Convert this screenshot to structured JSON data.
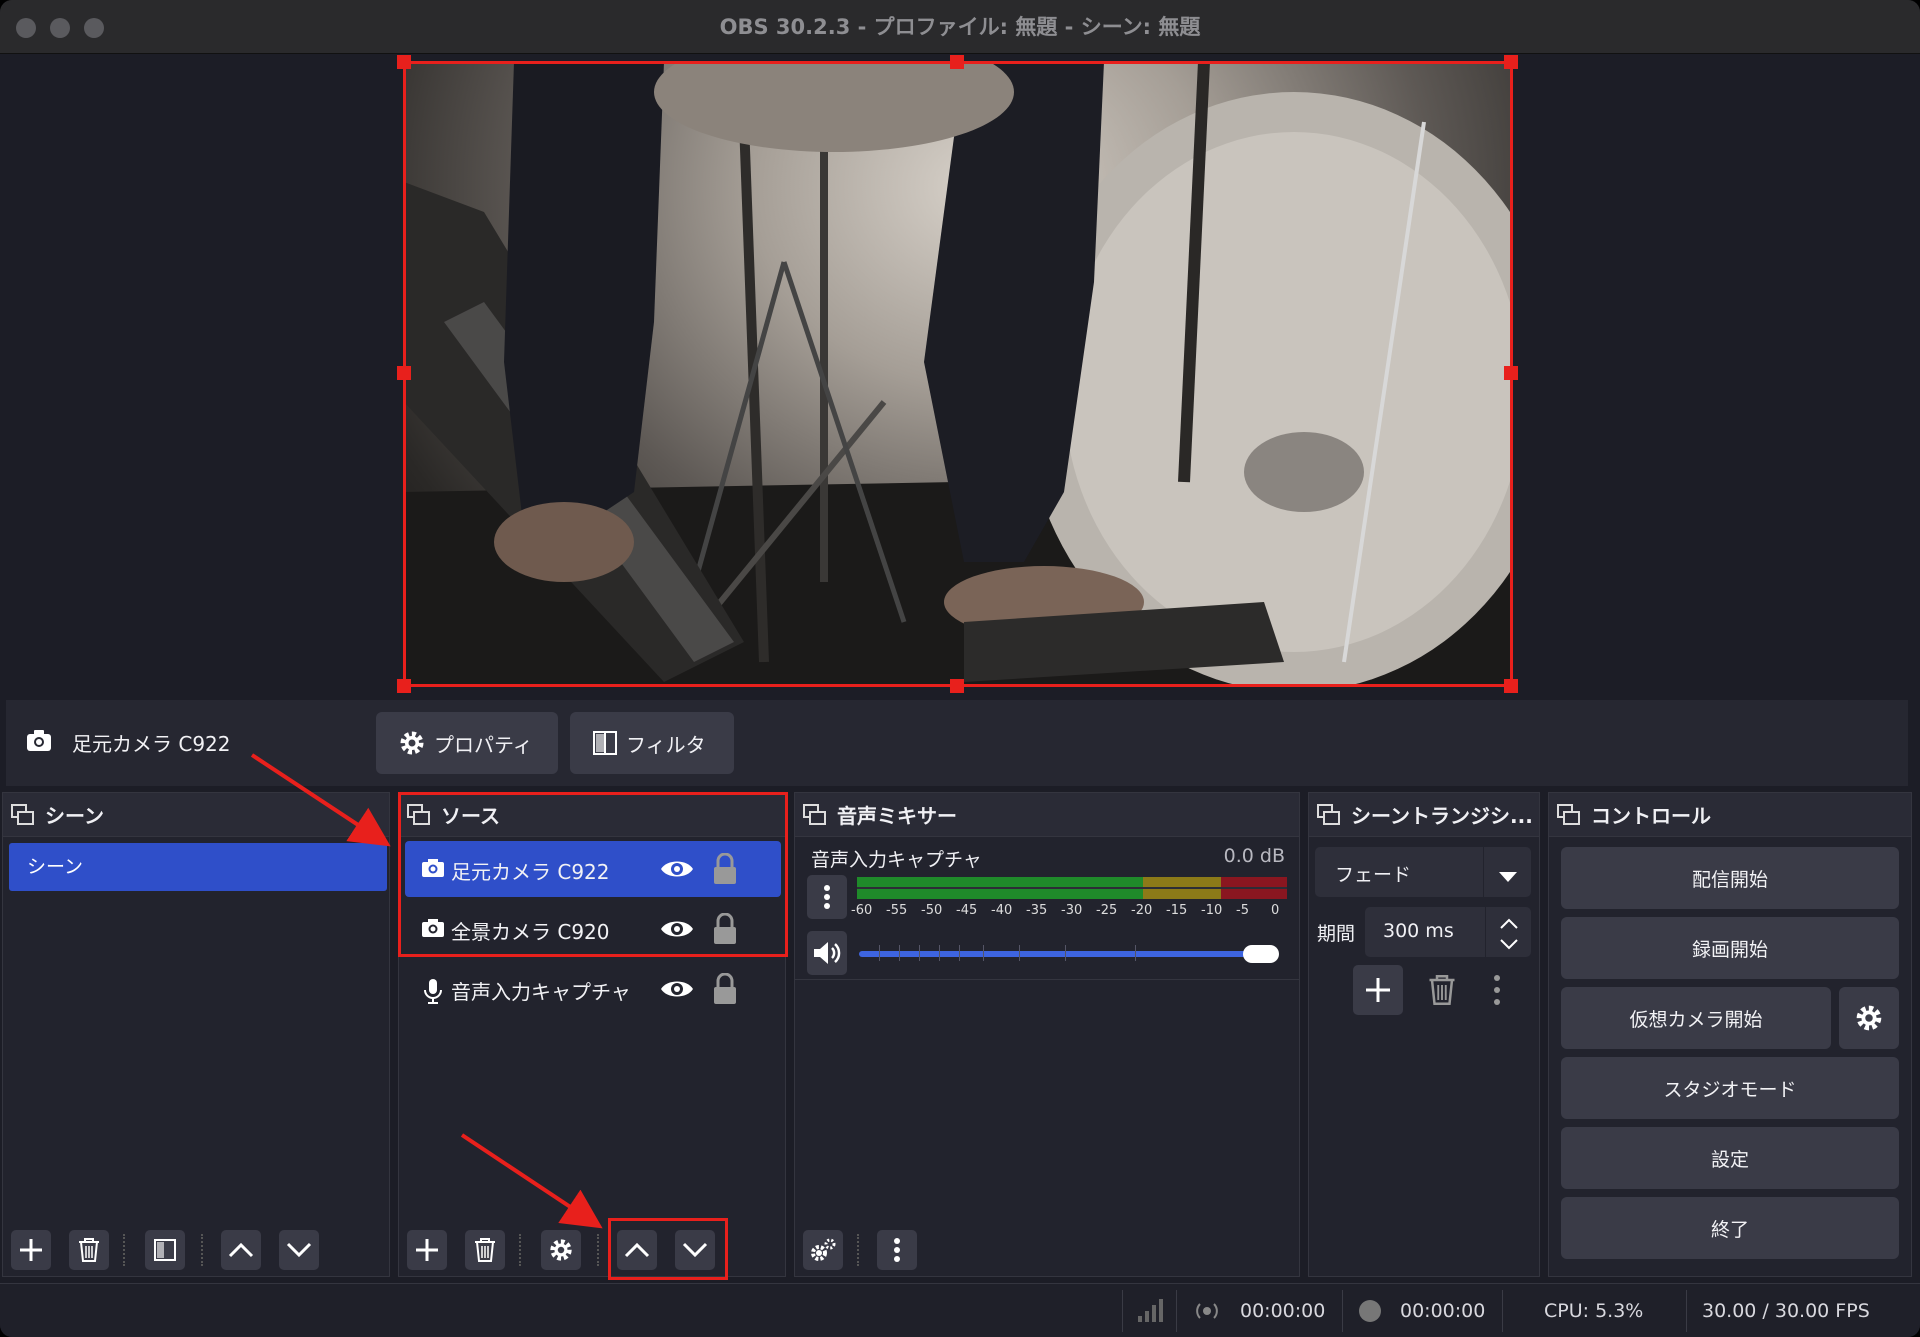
{
  "window": {
    "title": "OBS 30.2.3 - プロファイル: 無題 - シーン: 無題"
  },
  "source_toolbar": {
    "current_source": "足元カメラ C922",
    "properties_label": "プロパティ",
    "filters_label": "フィルタ"
  },
  "scenes": {
    "title": "シーン",
    "items": [
      {
        "label": "シーン",
        "selected": true
      }
    ]
  },
  "sources": {
    "title": "ソース",
    "items": [
      {
        "label": "足元カメラ C922",
        "icon": "camera-icon",
        "selected": true
      },
      {
        "label": "全景カメラ C920",
        "icon": "camera-icon",
        "selected": false
      },
      {
        "label": "音声入力キャプチャ",
        "icon": "microphone-icon",
        "selected": false
      }
    ]
  },
  "mixer": {
    "title": "音声ミキサー",
    "channel_name": "音声入力キャプチャ",
    "level": "0.0 dB",
    "scale": [
      "-60",
      "-55",
      "-50",
      "-45",
      "-40",
      "-35",
      "-30",
      "-25",
      "-20",
      "-15",
      "-10",
      "-5",
      "0"
    ],
    "volume_fraction": 1.0
  },
  "transitions": {
    "title": "シーントランジシ...",
    "selected": "フェード",
    "duration_label": "期間",
    "duration_value": "300 ms"
  },
  "controls": {
    "title": "コントロール",
    "start_streaming": "配信開始",
    "start_recording": "録画開始",
    "start_virtual_camera": "仮想カメラ開始",
    "studio_mode": "スタジオモード",
    "settings": "設定",
    "exit": "終了"
  },
  "status": {
    "stream_time": "00:00:00",
    "record_time": "00:00:00",
    "cpu": "CPU: 5.3%",
    "fps": "30.00 / 30.00 FPS"
  },
  "colors": {
    "accent": "#2f4fc9",
    "highlight_red": "#e8201c",
    "background": "#1c1d26"
  }
}
